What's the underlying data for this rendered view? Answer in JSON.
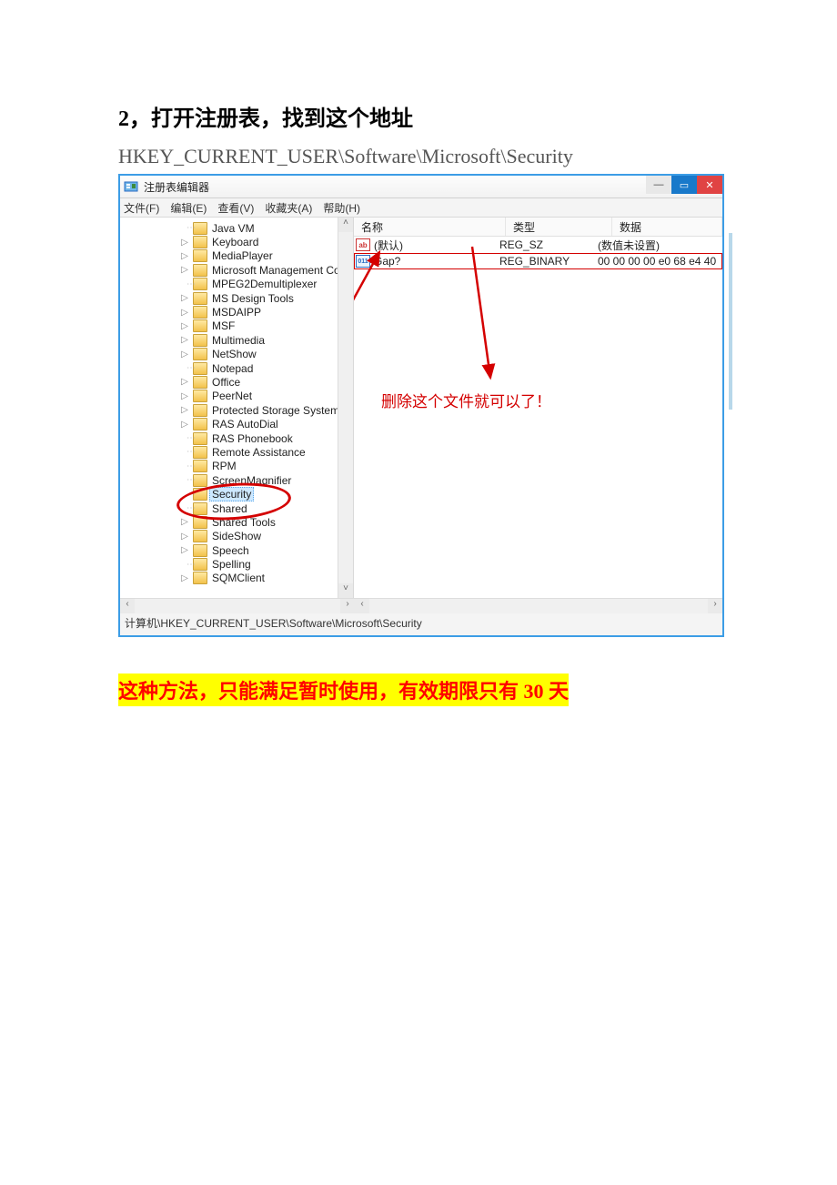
{
  "doc": {
    "heading": "2，打开注册表，找到这个地址",
    "path": "HKEY_CURRENT_USER\\Software\\Microsoft\\Security",
    "warning": "这种方法，只能满足暂时使用，有效期限只有 30 天"
  },
  "regedit": {
    "title": "注册表编辑器",
    "menu": {
      "file": "文件(F)",
      "edit": "编辑(E)",
      "view": "查看(V)",
      "favorites": "收藏夹(A)",
      "help": "帮助(H)"
    },
    "tree": [
      {
        "label": "Java VM",
        "exp": ""
      },
      {
        "label": "Keyboard",
        "exp": "▷"
      },
      {
        "label": "MediaPlayer",
        "exp": "▷"
      },
      {
        "label": "Microsoft Management Conso",
        "exp": "▷"
      },
      {
        "label": "MPEG2Demultiplexer",
        "exp": ""
      },
      {
        "label": "MS Design Tools",
        "exp": "▷"
      },
      {
        "label": "MSDAIPP",
        "exp": "▷"
      },
      {
        "label": "MSF",
        "exp": "▷"
      },
      {
        "label": "Multimedia",
        "exp": "▷"
      },
      {
        "label": "NetShow",
        "exp": "▷"
      },
      {
        "label": "Notepad",
        "exp": ""
      },
      {
        "label": "Office",
        "exp": "▷"
      },
      {
        "label": "PeerNet",
        "exp": "▷"
      },
      {
        "label": "Protected Storage System Prov",
        "exp": "▷"
      },
      {
        "label": "RAS AutoDial",
        "exp": "▷"
      },
      {
        "label": "RAS Phonebook",
        "exp": ""
      },
      {
        "label": "Remote Assistance",
        "exp": ""
      },
      {
        "label": "RPM",
        "exp": ""
      },
      {
        "label": "ScreenMagnifier",
        "exp": ""
      },
      {
        "label": "Security",
        "exp": "",
        "selected": true
      },
      {
        "label": "Shared",
        "exp": ""
      },
      {
        "label": "Shared Tools",
        "exp": "▷"
      },
      {
        "label": "SideShow",
        "exp": "▷"
      },
      {
        "label": "Speech",
        "exp": "▷"
      },
      {
        "label": "Spelling",
        "exp": ""
      },
      {
        "label": "SQMClient",
        "exp": "▷"
      }
    ],
    "list": {
      "headers": {
        "name": "名称",
        "type": "类型",
        "data": "数据"
      },
      "rows": [
        {
          "icon": "ab",
          "name": "(默认)",
          "type": "REG_SZ",
          "data": "(数值未设置)",
          "hl": false
        },
        {
          "icon": "bin",
          "name": "Gap?",
          "type": "REG_BINARY",
          "data": "00 00 00 00 e0 68 e4 40",
          "hl": true
        }
      ]
    },
    "annotation": "删除这个文件就可以了！",
    "statusbar": "计算机\\HKEY_CURRENT_USER\\Software\\Microsoft\\Security"
  }
}
